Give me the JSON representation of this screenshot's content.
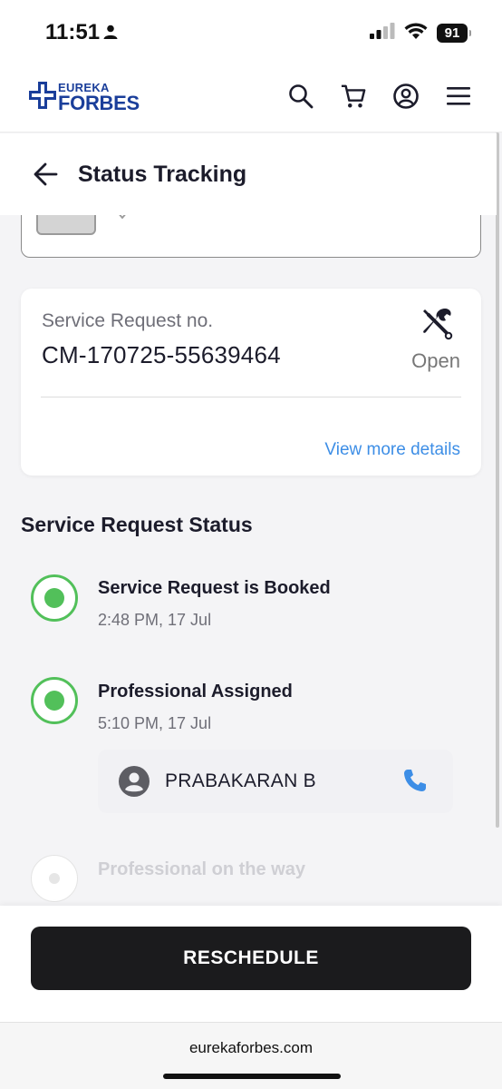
{
  "status_bar": {
    "time": "11:51",
    "battery": "91"
  },
  "header": {
    "logo_top": "EUREKA",
    "logo_bottom": "FORBES",
    "brand_color": "#1a3e9a"
  },
  "page": {
    "title": "Status Tracking"
  },
  "request": {
    "label": "Service Request no.",
    "number": "CM-170725-55639464",
    "status": "Open",
    "view_more": "View more details"
  },
  "status_section": {
    "title": "Service Request Status",
    "steps": [
      {
        "title": "Service Request is Booked",
        "time": "2:48 PM, 17 Jul",
        "state": "done"
      },
      {
        "title": "Professional Assigned",
        "time": "5:10 PM, 17 Jul",
        "state": "done"
      },
      {
        "title": "Professional on the way",
        "state": "pending"
      }
    ],
    "assignee": "PRABAKARAN B",
    "accent_color": "#52c05a"
  },
  "actions": {
    "reschedule": "RESCHEDULE"
  },
  "browser": {
    "url": "eurekaforbes.com"
  }
}
